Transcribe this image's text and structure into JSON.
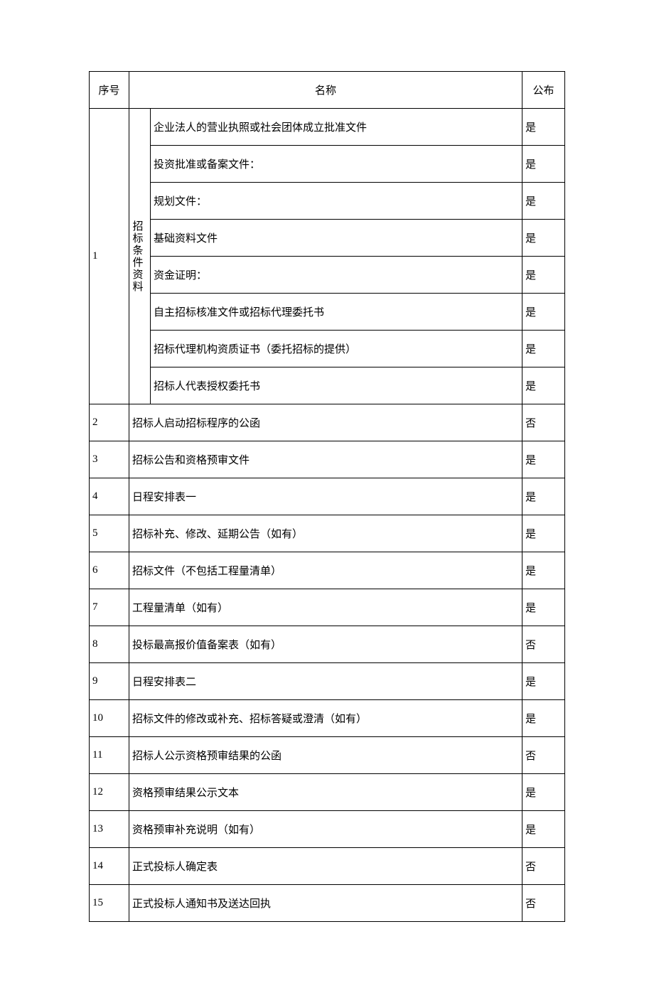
{
  "headers": {
    "seq": "序号",
    "name": "名称",
    "pub": "公布"
  },
  "category_label": "招标条件资料",
  "group1": {
    "seq": "1",
    "items": [
      {
        "name": "企业法人的营业执照或社会团体成立批准文件",
        "pub": "是"
      },
      {
        "name": "投资批准或备案文件：",
        "pub": "是"
      },
      {
        "name": "规划文件：",
        "pub": "是"
      },
      {
        "name": "基础资料文件",
        "pub": "是"
      },
      {
        "name": "资金证明：",
        "pub": "是"
      },
      {
        "name": "自主招标核准文件或招标代理委托书",
        "pub": "是"
      },
      {
        "name": "招标代理机构资质证书（委托招标的提供）",
        "pub": "是"
      },
      {
        "name": "招标人代表授权委托书",
        "pub": "是"
      }
    ]
  },
  "rows": [
    {
      "seq": "2",
      "name": "招标人启动招标程序的公函",
      "pub": "否"
    },
    {
      "seq": "3",
      "name": "招标公告和资格预审文件",
      "pub": "是"
    },
    {
      "seq": "4",
      "name": "日程安排表一",
      "pub": "是"
    },
    {
      "seq": "5",
      "name": "招标补充、修改、延期公告（如有）",
      "pub": "是"
    },
    {
      "seq": "6",
      "name": "招标文件（不包括工程量清单）",
      "pub": "是"
    },
    {
      "seq": "7",
      "name": "工程量清单（如有）",
      "pub": "是"
    },
    {
      "seq": "8",
      "name": "投标最高报价值备案表（如有）",
      "pub": "否"
    },
    {
      "seq": "9",
      "name": "日程安排表二",
      "pub": "是"
    },
    {
      "seq": "10",
      "name": "招标文件的修改或补充、招标答疑或澄清（如有）",
      "pub": "是"
    },
    {
      "seq": "11",
      "name": "招标人公示资格预审结果的公函",
      "pub": "否"
    },
    {
      "seq": "12",
      "name": "资格预审结果公示文本",
      "pub": "是"
    },
    {
      "seq": "13",
      "name": "资格预审补充说明（如有）",
      "pub": "是"
    },
    {
      "seq": "14",
      "name": "正式投标人确定表",
      "pub": "否"
    },
    {
      "seq": "15",
      "name": "正式投标人通知书及送达回执",
      "pub": "否"
    }
  ]
}
